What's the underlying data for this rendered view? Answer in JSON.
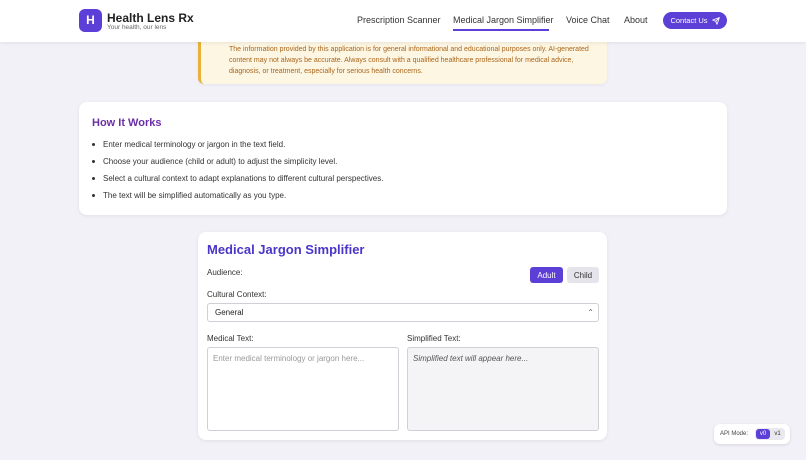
{
  "brand": {
    "logo_letter": "H",
    "name": "Health Lens Rx",
    "tagline": "Your health, our lens",
    "accent_color": "#5b3fd6"
  },
  "nav": {
    "items": [
      {
        "label": "Prescription Scanner",
        "active": false
      },
      {
        "label": "Medical Jargon Simplifier",
        "active": true
      },
      {
        "label": "Voice Chat",
        "active": false
      },
      {
        "label": "About",
        "active": false
      }
    ],
    "contact_label": "Contact Us",
    "contact_icon": "send-icon"
  },
  "disclaimer": {
    "text": "The information provided by this application is for general informational and educational purposes only. AI-generated content may not always be accurate. Always consult with a qualified healthcare professional for medical advice, diagnosis, or treatment, especially for serious health concerns."
  },
  "how_it_works": {
    "title": "How It Works",
    "steps": [
      "Enter medical terminology or jargon in the text field.",
      "Choose your audience (child or adult) to adjust the simplicity level.",
      "Select a cultural context to adapt explanations to different cultural perspectives.",
      "The text will be simplified automatically as you type."
    ]
  },
  "simplifier": {
    "title": "Medical Jargon Simplifier",
    "audience_label": "Audience:",
    "audience_options": [
      "Adult",
      "Child"
    ],
    "audience_selected": "Adult",
    "cultural_label": "Cultural Context:",
    "cultural_value": "General",
    "input_label": "Medical Text:",
    "input_placeholder": "Enter medical terminology or jargon here...",
    "output_label": "Simplified Text:",
    "output_placeholder": "Simplified text will appear here..."
  },
  "api_mode": {
    "label": "API Mode:",
    "options": [
      "v0",
      "v1"
    ],
    "selected": "v0"
  }
}
